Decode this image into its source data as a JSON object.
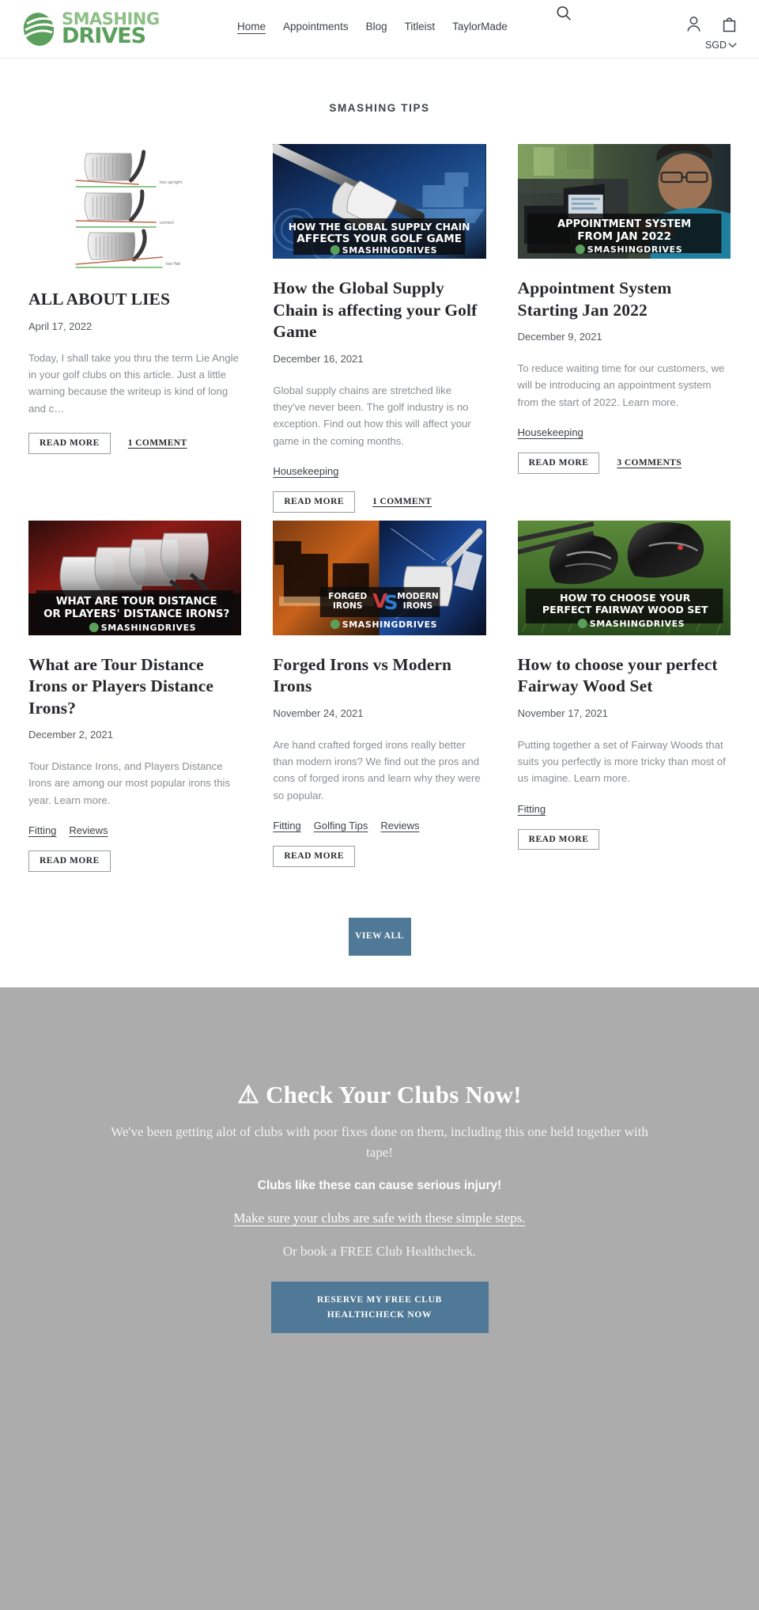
{
  "header": {
    "logo": {
      "line1": "SMASHING",
      "line2": "DRIVES",
      "icon": "smashing-drives-logo"
    },
    "nav": [
      {
        "label": "Home",
        "active": true
      },
      {
        "label": "Appointments",
        "active": false
      },
      {
        "label": "Blog",
        "active": false
      },
      {
        "label": "Titleist",
        "active": false
      },
      {
        "label": "TaylorMade",
        "active": false
      }
    ],
    "search_icon": "search-icon",
    "account_icon": "account-icon",
    "cart_icon": "shopping-bag-icon",
    "currency": {
      "value": "SGD",
      "chevron": "chevron-down-icon"
    }
  },
  "blog": {
    "section_title": "SMASHING TIPS",
    "view_all_label": "VIEW ALL",
    "read_more_label": "READ MORE",
    "cards": [
      {
        "image_kind": "lie-angle-diagram",
        "image_labels": [
          "too upright",
          "correct",
          "too flat"
        ],
        "title": "ALL ABOUT LIES",
        "date": "April 17, 2022",
        "excerpt": "Today, I shall take you thru the term Lie Angle in your golf clubs on this article. Just a little warning because the writeup is kind of long and c…",
        "tags": [],
        "comments": "1 COMMENT"
      },
      {
        "image_kind": "supply-chain-photo",
        "image_caption_line1": "HOW THE GLOBAL SUPPLY CHAIN",
        "image_caption_line2": "AFFECTS YOUR GOLF GAME",
        "image_logo": "SMASHINGDRIVES",
        "title": "How the Global Supply Chain is affecting your Golf Game",
        "date": "December 16, 2021",
        "excerpt": "Global supply chains are stretched like they've never been. The golf industry is no exception.  Find out how this will affect your game in the coming months.",
        "tags": [
          "Housekeeping"
        ],
        "comments": "1 COMMENT"
      },
      {
        "image_kind": "appointment-photo",
        "image_caption_line1": "APPOINTMENT SYSTEM",
        "image_caption_line2": "FROM JAN 2022",
        "image_logo": "SMASHINGDRIVES",
        "title": "Appointment System Starting Jan 2022",
        "date": "December 9, 2021",
        "excerpt": "To reduce waiting time for our customers, we will be introducing an appointment system from the start of 2022.  Learn more.",
        "tags": [
          "Housekeeping"
        ],
        "comments": "3 COMMENTS"
      },
      {
        "image_kind": "tour-distance-irons-photo",
        "image_caption_line1": "WHAT ARE TOUR DISTANCE",
        "image_caption_line2": "OR PLAYERS' DISTANCE IRONS?",
        "image_logo": "SMASHINGDRIVES",
        "title": "What are Tour Distance Irons or Players Distance Irons?",
        "date": "December 2, 2021",
        "excerpt": "Tour Distance Irons, and Players Distance Irons are among our most popular irons this year.  Learn more.",
        "tags": [
          "Fitting",
          "Reviews"
        ],
        "comments": null
      },
      {
        "image_kind": "forged-vs-modern-photo",
        "image_caption_line1": "FORGED IRONS",
        "image_caption_vs": "VS",
        "image_caption_line2": "MODERN IRONS",
        "image_logo": "SMASHINGDRIVES",
        "title": "Forged Irons vs Modern Irons",
        "date": "November 24, 2021",
        "excerpt": "Are hand crafted forged irons really better than modern irons? We find out the pros and cons of forged irons and learn why they were so popular.",
        "tags": [
          "Fitting",
          "Golfing Tips",
          "Reviews"
        ],
        "comments": null
      },
      {
        "image_kind": "fairway-wood-photo",
        "image_caption_line1": "HOW TO CHOOSE YOUR",
        "image_caption_line2": "PERFECT FAIRWAY WOOD SET",
        "image_logo": "SMASHINGDRIVES",
        "title": "How to choose your perfect Fairway Wood Set",
        "date": "November 17, 2021",
        "excerpt": "Putting together a set of Fairway Woods that suits you perfectly is more tricky than most of us imagine. Learn more.",
        "tags": [
          "Fitting"
        ],
        "comments": null
      }
    ]
  },
  "cta": {
    "title": "⚠ Check Your Clubs Now!",
    "subtitle": "We've been getting alot of clubs with poor fixes done on them, including this one held together with tape!",
    "bold_line": "Clubs like these can cause serious injury!",
    "link": "Make sure your clubs are safe with these simple steps.",
    "or_line": "Or book a FREE Club Healthcheck.",
    "button": "RESERVE MY FREE CLUB HEALTHCHECK NOW"
  },
  "colors": {
    "accent_blue": "#4f7996",
    "logo_green_light": "#8dbf86",
    "logo_green_dark": "#5aa05c",
    "cta_background": "#acacac"
  }
}
